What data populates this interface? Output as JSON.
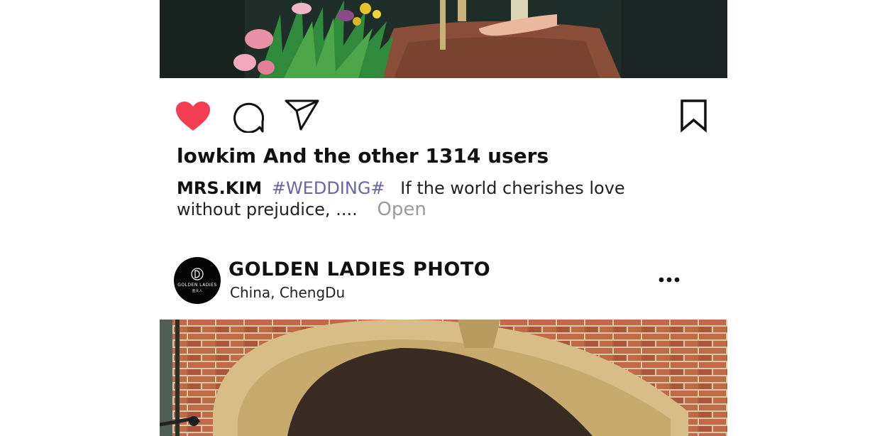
{
  "post1": {
    "image_alt": "Wedding photo with flowers and hands on table",
    "likes_text": "lowkim And the other 1314 users",
    "caption": {
      "username": "MRS.KIM",
      "hashtag": "#WEDDING#",
      "text": "If the world cherishes love without prejudice, ....",
      "more_label": "Open"
    },
    "actions": {
      "like": "heart-icon",
      "comment": "comment-icon",
      "share": "send-icon",
      "save": "bookmark-icon"
    },
    "colors": {
      "like_active": "#f23d52",
      "hashtag": "#6a66a3",
      "muted": "#9a9a9a"
    }
  },
  "post2": {
    "account_name": "GOLDEN LADIES PHOTO",
    "location": "China,  ChengDu",
    "avatar_logo_text": "GOLDEN LADIES",
    "avatar_logo_sub": "金夫人",
    "more_icon": "more-horizontal-icon",
    "image_alt": "Couple photo in front of arched brick doorway"
  },
  "watermark": "GOLDEN LADIES"
}
